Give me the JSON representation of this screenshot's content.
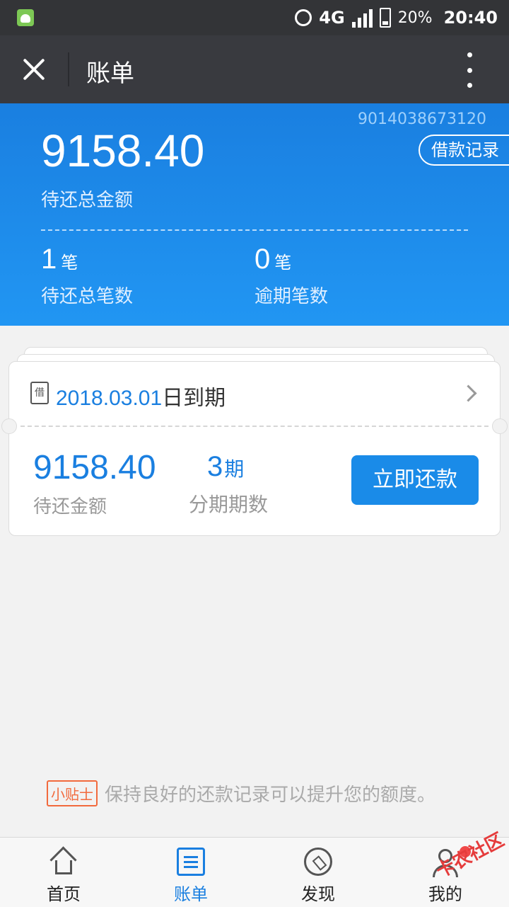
{
  "statusbar": {
    "network": "4G",
    "battery": "20%",
    "time": "20:40"
  },
  "header": {
    "title": "账单"
  },
  "summary": {
    "account_number": "9014038673120",
    "records_button": "借款记录",
    "total_amount": "9158.40",
    "total_amount_label": "待还总金额",
    "count": "1",
    "count_unit": "笔",
    "count_label": "待还总笔数",
    "overdue": "0",
    "overdue_unit": "笔",
    "overdue_label": "逾期笔数"
  },
  "bill_card": {
    "icon_text": "借",
    "due_date": "2018.03.01",
    "due_suffix": "日到期",
    "amount": "9158.40",
    "amount_label": "待还金额",
    "periods": "3",
    "periods_unit": "期",
    "periods_label": "分期期数",
    "pay_button": "立即还款"
  },
  "tip": {
    "tag": "小贴士",
    "text": "保持良好的还款记录可以提升您的额度。"
  },
  "tabs": [
    {
      "label": "首页",
      "icon": "home-icon"
    },
    {
      "label": "账单",
      "icon": "bill-icon"
    },
    {
      "label": "发现",
      "icon": "compass-icon"
    },
    {
      "label": "我的",
      "icon": "profile-icon"
    }
  ],
  "watermark": "卡农社区",
  "colors": {
    "accent": "#1a7fe0",
    "header_bg": "#393a3f",
    "tip": "#f26a3d"
  }
}
